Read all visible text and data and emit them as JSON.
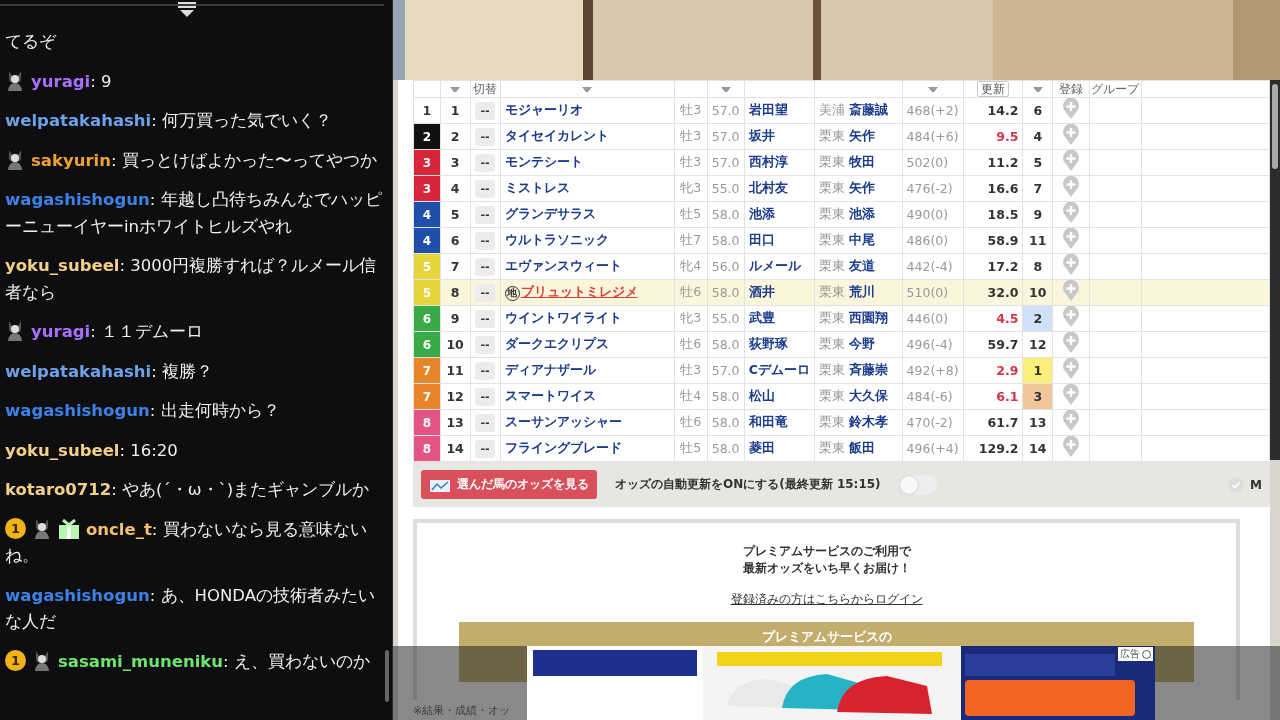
{
  "chat": {
    "messages": [
      {
        "text": "てるぞ"
      },
      {
        "badges": [
          {
            "kind": "avatar"
          }
        ],
        "user": "yuragi",
        "sep": ":",
        "color": "#a970ff",
        "text": "9"
      },
      {
        "user": "welpatakahashi",
        "sep": ":",
        "color": "#6ea2e8",
        "text": "何万買った気でいく？"
      },
      {
        "badges": [
          {
            "kind": "avatar"
          }
        ],
        "user": "sakyurin",
        "sep": ":",
        "color": "#f0a030",
        "text": "買っとけばよかった〜ってやつか"
      },
      {
        "user": "wagashishogun",
        "sep": ":",
        "color": "#3d82e6",
        "text": "年越し凸待ちみんなでハッピーニューイヤーinホワイトヒルズやれ"
      },
      {
        "user": "yoku_subeel",
        "sep": ":",
        "color": "#f3d08a",
        "text": "3000円複勝すれば？ルメール信者なら"
      },
      {
        "badges": [
          {
            "kind": "avatar"
          }
        ],
        "user": "yuragi",
        "sep": ":",
        "color": "#a970ff",
        "text": "１１デムーロ"
      },
      {
        "user": "welpatakahashi",
        "sep": ":",
        "color": "#6ea2e8",
        "text": "複勝？"
      },
      {
        "user": "wagashishogun",
        "sep": ":",
        "color": "#3d82e6",
        "text": "出走何時から？"
      },
      {
        "user": "yoku_subeel",
        "sep": ":",
        "color": "#f3d08a",
        "text": "16:20"
      },
      {
        "user": "kotaro0712",
        "sep": ":",
        "color": "#f3d08a",
        "text": "やあ(´・ω・`)またギャンブルか"
      },
      {
        "badges": [
          {
            "kind": "sub",
            "text": "1"
          },
          {
            "kind": "avatar"
          },
          {
            "kind": "gift"
          }
        ],
        "user": "oncle_t",
        "sep": ":",
        "color": "#f3c070",
        "text": "買わないなら見る意味ないね。"
      },
      {
        "user": "wagashishogun",
        "sep": ":",
        "color": "#3d82e6",
        "text": "あ、HONDAの技術者みたいな人だ"
      },
      {
        "badges": [
          {
            "kind": "sub",
            "text": "1"
          },
          {
            "kind": "avatar"
          }
        ],
        "user": "sasami_muneniku",
        "sep": ":",
        "color": "#6ee66e",
        "text": "え、買わないのか"
      }
    ]
  },
  "table": {
    "header": {
      "switch": "切替",
      "refresh": "更新",
      "register": "登録",
      "group": "グループ"
    },
    "rows": [
      {
        "waku": "1",
        "color": "#ffffff",
        "num": "1",
        "toggle": "--",
        "name": "モジャーリオ",
        "highlighted": false,
        "sex_age": "牡3",
        "weight": "57.0",
        "jockey": "岩田望",
        "stable": "美浦",
        "trainer": "斎藤誠",
        "body": "468(+2)",
        "odds": "14.2",
        "hot": false,
        "popularity": {
          "value": "6"
        }
      },
      {
        "waku": "2",
        "color": "#111111",
        "num": "2",
        "toggle": "--",
        "name": "タイセイカレント",
        "highlighted": false,
        "sex_age": "牡3",
        "weight": "57.0",
        "jockey": "坂井",
        "stable": "栗東",
        "trainer": "矢作",
        "body": "484(+6)",
        "odds": "9.5",
        "hot": true,
        "popularity": {
          "value": "4"
        }
      },
      {
        "waku": "3",
        "color": "#d9253a",
        "num": "3",
        "toggle": "--",
        "name": "モンテシート",
        "highlighted": false,
        "sex_age": "牡3",
        "weight": "57.0",
        "jockey": "西村淳",
        "stable": "栗東",
        "trainer": "牧田",
        "body": "502(0)",
        "odds": "11.2",
        "hot": false,
        "popularity": {
          "value": "5"
        }
      },
      {
        "waku": "3",
        "color": "#d9253a",
        "num": "4",
        "toggle": "--",
        "name": "ミストレス",
        "highlighted": false,
        "sex_age": "牝3",
        "weight": "55.0",
        "jockey": "北村友",
        "stable": "栗東",
        "trainer": "矢作",
        "body": "476(-2)",
        "odds": "16.6",
        "hot": false,
        "popularity": {
          "value": "7"
        }
      },
      {
        "waku": "4",
        "color": "#1f4fa8",
        "num": "5",
        "toggle": "--",
        "name": "グランデサラス",
        "highlighted": false,
        "sex_age": "牡5",
        "weight": "58.0",
        "jockey": "池添",
        "stable": "栗東",
        "trainer": "池添",
        "body": "490(0)",
        "odds": "18.5",
        "hot": false,
        "popularity": {
          "value": "9"
        }
      },
      {
        "waku": "4",
        "color": "#1f4fa8",
        "num": "6",
        "toggle": "--",
        "name": "ウルトラソニック",
        "highlighted": false,
        "sex_age": "牡7",
        "weight": "58.0",
        "jockey": "田口",
        "stable": "栗東",
        "trainer": "中尾",
        "body": "486(0)",
        "odds": "58.9",
        "hot": false,
        "popularity": {
          "value": "11"
        }
      },
      {
        "waku": "5",
        "color": "#e6d53a",
        "num": "7",
        "toggle": "--",
        "name": "エヴァンスウィート",
        "highlighted": false,
        "sex_age": "牝4",
        "weight": "56.0",
        "jockey": "ルメール",
        "stable": "栗東",
        "trainer": "友道",
        "body": "442(-4)",
        "odds": "17.2",
        "hot": false,
        "popularity": {
          "value": "8"
        }
      },
      {
        "waku": "5",
        "color": "#e6d53a",
        "num": "8",
        "toggle": "--",
        "name": "ブリュットミレジメ",
        "local_mark": "地",
        "highlighted": true,
        "sex_age": "牡6",
        "weight": "58.0",
        "jockey": "酒井",
        "stable": "栗東",
        "trainer": "荒川",
        "body": "510(0)",
        "odds": "32.0",
        "hot": false,
        "popularity": {
          "value": "10"
        }
      },
      {
        "waku": "6",
        "color": "#3aaa48",
        "num": "9",
        "toggle": "--",
        "name": "ウイントワイライト",
        "highlighted": false,
        "sex_age": "牝3",
        "weight": "55.0",
        "jockey": "武豊",
        "stable": "栗東",
        "trainer": "西園翔",
        "body": "446(0)",
        "odds": "4.5",
        "hot": true,
        "popularity": {
          "value": "2",
          "color": "#cfe0f7"
        }
      },
      {
        "waku": "6",
        "color": "#3aaa48",
        "num": "10",
        "toggle": "--",
        "name": "ダークエクリプス",
        "highlighted": false,
        "sex_age": "牡6",
        "weight": "58.0",
        "jockey": "荻野琢",
        "stable": "栗東",
        "trainer": "今野",
        "body": "496(-4)",
        "odds": "59.7",
        "hot": false,
        "popularity": {
          "value": "12"
        }
      },
      {
        "waku": "7",
        "color": "#e8842a",
        "num": "11",
        "toggle": "--",
        "name": "ディアナザール",
        "highlighted": false,
        "sex_age": "牡3",
        "weight": "57.0",
        "jockey": "Cデムーロ",
        "stable": "栗東",
        "trainer": "斉藤崇",
        "body": "492(+8)",
        "odds": "2.9",
        "hot": true,
        "popularity": {
          "value": "1",
          "color": "#f9ef7a"
        }
      },
      {
        "waku": "7",
        "color": "#e8842a",
        "num": "12",
        "toggle": "--",
        "name": "スマートワイス",
        "highlighted": false,
        "sex_age": "牡4",
        "weight": "58.0",
        "jockey": "松山",
        "stable": "栗東",
        "trainer": "大久保",
        "body": "484(-6)",
        "odds": "6.1",
        "hot": true,
        "popularity": {
          "value": "3",
          "color": "#f0c69a"
        }
      },
      {
        "waku": "8",
        "color": "#e25582",
        "num": "13",
        "toggle": "--",
        "name": "スーサンアッシャー",
        "highlighted": false,
        "sex_age": "牡6",
        "weight": "58.0",
        "jockey": "和田竜",
        "stable": "栗東",
        "trainer": "鈴木孝",
        "body": "470(-2)",
        "odds": "61.7",
        "hot": false,
        "popularity": {
          "value": "13"
        }
      },
      {
        "waku": "8",
        "color": "#e25582",
        "num": "14",
        "toggle": "--",
        "name": "フライングブレード",
        "highlighted": false,
        "sex_age": "牡5",
        "weight": "58.0",
        "jockey": "菱田",
        "stable": "栗東",
        "trainer": "飯田",
        "body": "496(+4)",
        "odds": "129.2",
        "hot": false,
        "popularity": {
          "value": "14"
        }
      }
    ]
  },
  "toolbar": {
    "odds_button": "選んだ馬のオッズを見る",
    "auto_update": "オッズの自動更新をONにする(最終更新 15:15)",
    "auto_update_on": false,
    "right_label": "M"
  },
  "premium": {
    "line1": "プレミアムサービスのご利用で",
    "line2": "最新オッズをいち早くお届け！",
    "login_link": "登録済みの方はこちらからログイン",
    "gold_button": "プレミアムサービスの",
    "footnote": "※結果・成績・オッ"
  },
  "ad": {
    "label": "広告"
  }
}
